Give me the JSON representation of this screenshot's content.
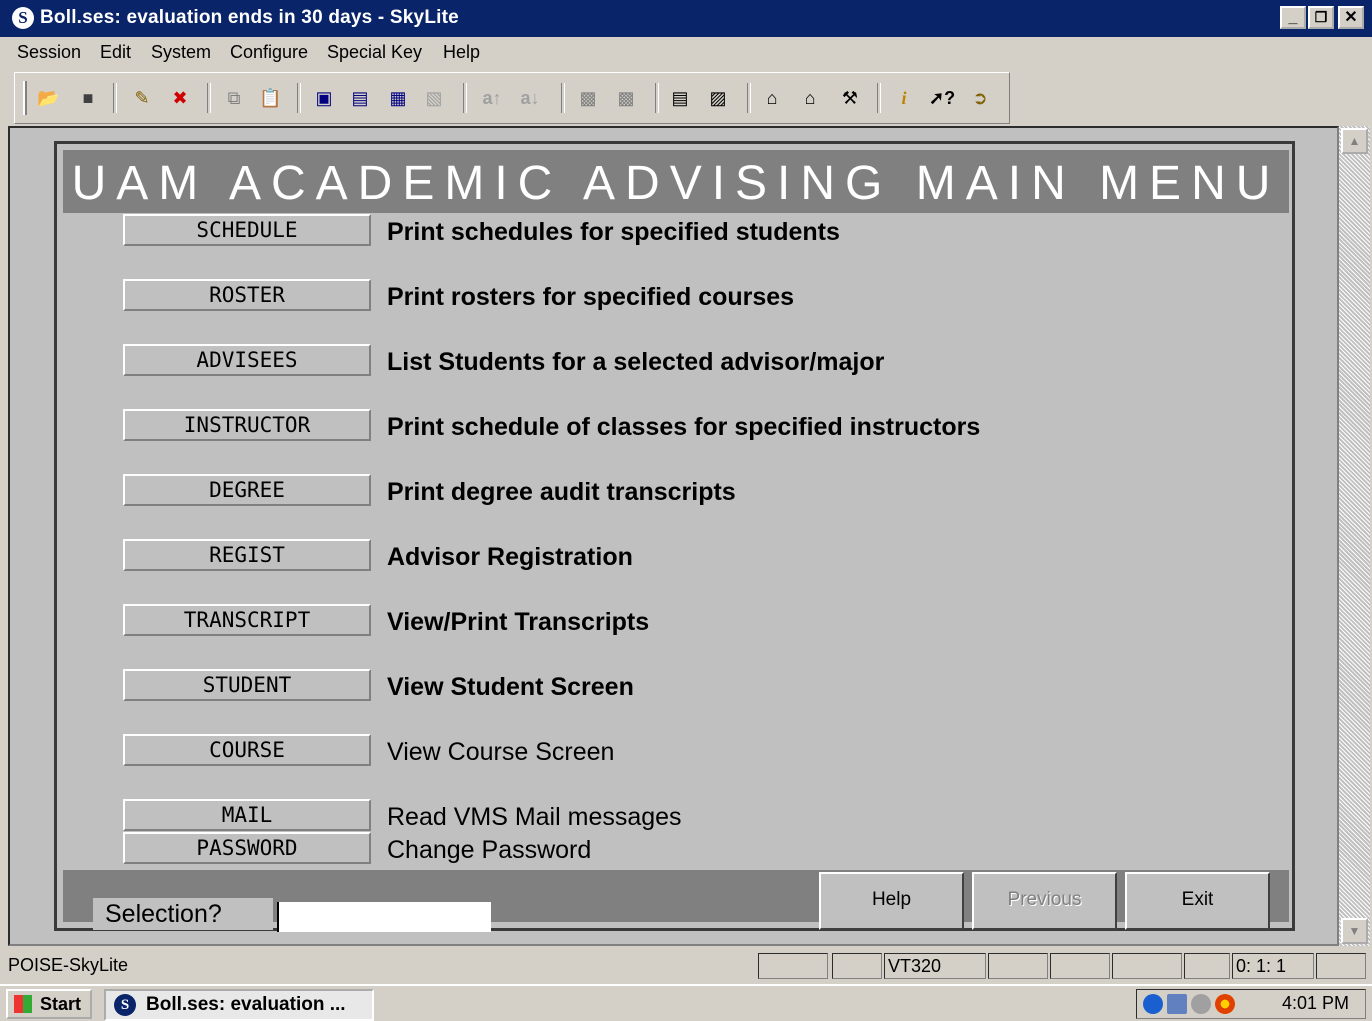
{
  "window": {
    "icon": "S",
    "title": "Boll.ses:  evaluation ends in 30 days - SkyLite",
    "minimize": "_",
    "maximize": "❐",
    "close": "✕"
  },
  "menubar": [
    "Session",
    "Edit",
    "System",
    "Configure",
    "Special Key",
    "Help"
  ],
  "toolbar": {
    "icons": [
      "open-folder-icon",
      "save-icon",
      "new-session-icon",
      "delete-session-icon",
      "copy-icon",
      "paste-icon",
      "record-icon",
      "stop-icon",
      "transfer-icon",
      "receive-icon",
      "font-increase-icon",
      "font-decrease-icon",
      "capture-icon",
      "playback-icon",
      "print-icon",
      "print-setup-icon",
      "host-config-icon",
      "terminal-config-icon",
      "tools-icon",
      "info-icon",
      "context-help-icon",
      "exit-icon"
    ]
  },
  "screen": {
    "title": "UAM ACADEMIC ADVISING MAIN MENU",
    "menu": [
      {
        "key": "SCHEDULE",
        "desc": "Print schedules for specified students"
      },
      {
        "key": "ROSTER",
        "desc": "Print rosters for specified courses"
      },
      {
        "key": "ADVISEES",
        "desc": "List Students for a selected advisor/major"
      },
      {
        "key": "INSTRUCTOR",
        "desc": "Print schedule of classes for specified instructors"
      },
      {
        "key": "DEGREE",
        "desc": "Print degree audit transcripts"
      },
      {
        "key": "REGIST",
        "desc": "Advisor Registration"
      },
      {
        "key": "TRANSCRIPT",
        "desc": "View/Print Transcripts"
      },
      {
        "key": "STUDENT",
        "desc": "View Student Screen"
      },
      {
        "key": "COURSE",
        "desc": "View Course Screen"
      },
      {
        "key": "MAIL",
        "desc": "Read VMS Mail messages"
      },
      {
        "key": "PASSWORD",
        "desc": "Change Password"
      }
    ],
    "selection_label": "Selection?",
    "selection_value": "",
    "buttons": {
      "help": "Help",
      "previous": "Previous",
      "exit": "Exit"
    }
  },
  "statusbar": {
    "text": "POISE-SkyLite",
    "terminal": "VT320",
    "cursor": "0:  1:  1"
  },
  "taskbar": {
    "start": "Start",
    "task": "Boll.ses:  evaluation ...",
    "clock": "4:01 PM"
  }
}
